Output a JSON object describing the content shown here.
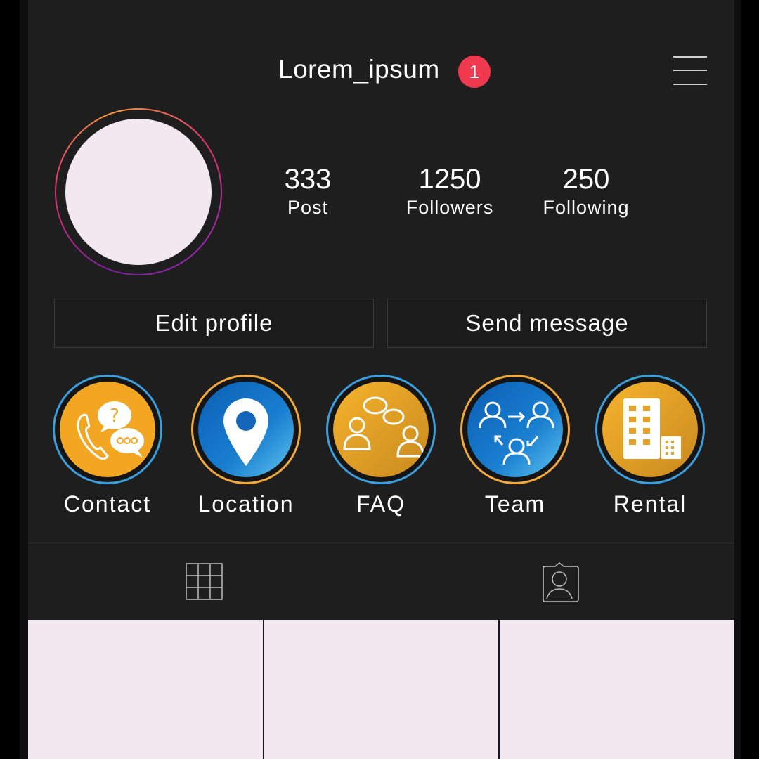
{
  "header": {
    "username": "Lorem_ipsum",
    "notification_count": "1",
    "menu_icon": "hamburger-menu-icon"
  },
  "profile": {
    "avatar_icon": "avatar-placeholder"
  },
  "stats": [
    {
      "value": "333",
      "label": "Post"
    },
    {
      "value": "1250",
      "label": "Followers"
    },
    {
      "value": "250",
      "label": "Following"
    }
  ],
  "actions": {
    "edit_profile": "Edit profile",
    "send_message": "Send message"
  },
  "highlights": [
    {
      "label": "Contact",
      "icon": "phone-question-chat-icon",
      "ring": "blue"
    },
    {
      "label": "Location",
      "icon": "map-pin-icon",
      "ring": "gold"
    },
    {
      "label": "FAQ",
      "icon": "people-chat-icon",
      "ring": "blue"
    },
    {
      "label": "Team",
      "icon": "team-network-icon",
      "ring": "gold"
    },
    {
      "label": "Rental",
      "icon": "building-icon",
      "ring": "blue"
    }
  ],
  "tabs": [
    {
      "name": "posts-grid",
      "icon": "grid-icon"
    },
    {
      "name": "tagged",
      "icon": "tagged-person-icon"
    }
  ],
  "colors": {
    "badge": "#f0384f",
    "gold": "#f2a93b",
    "blue": "#1a6fc4",
    "background": "#1e1e1e",
    "placeholder": "#f3e8f0"
  }
}
